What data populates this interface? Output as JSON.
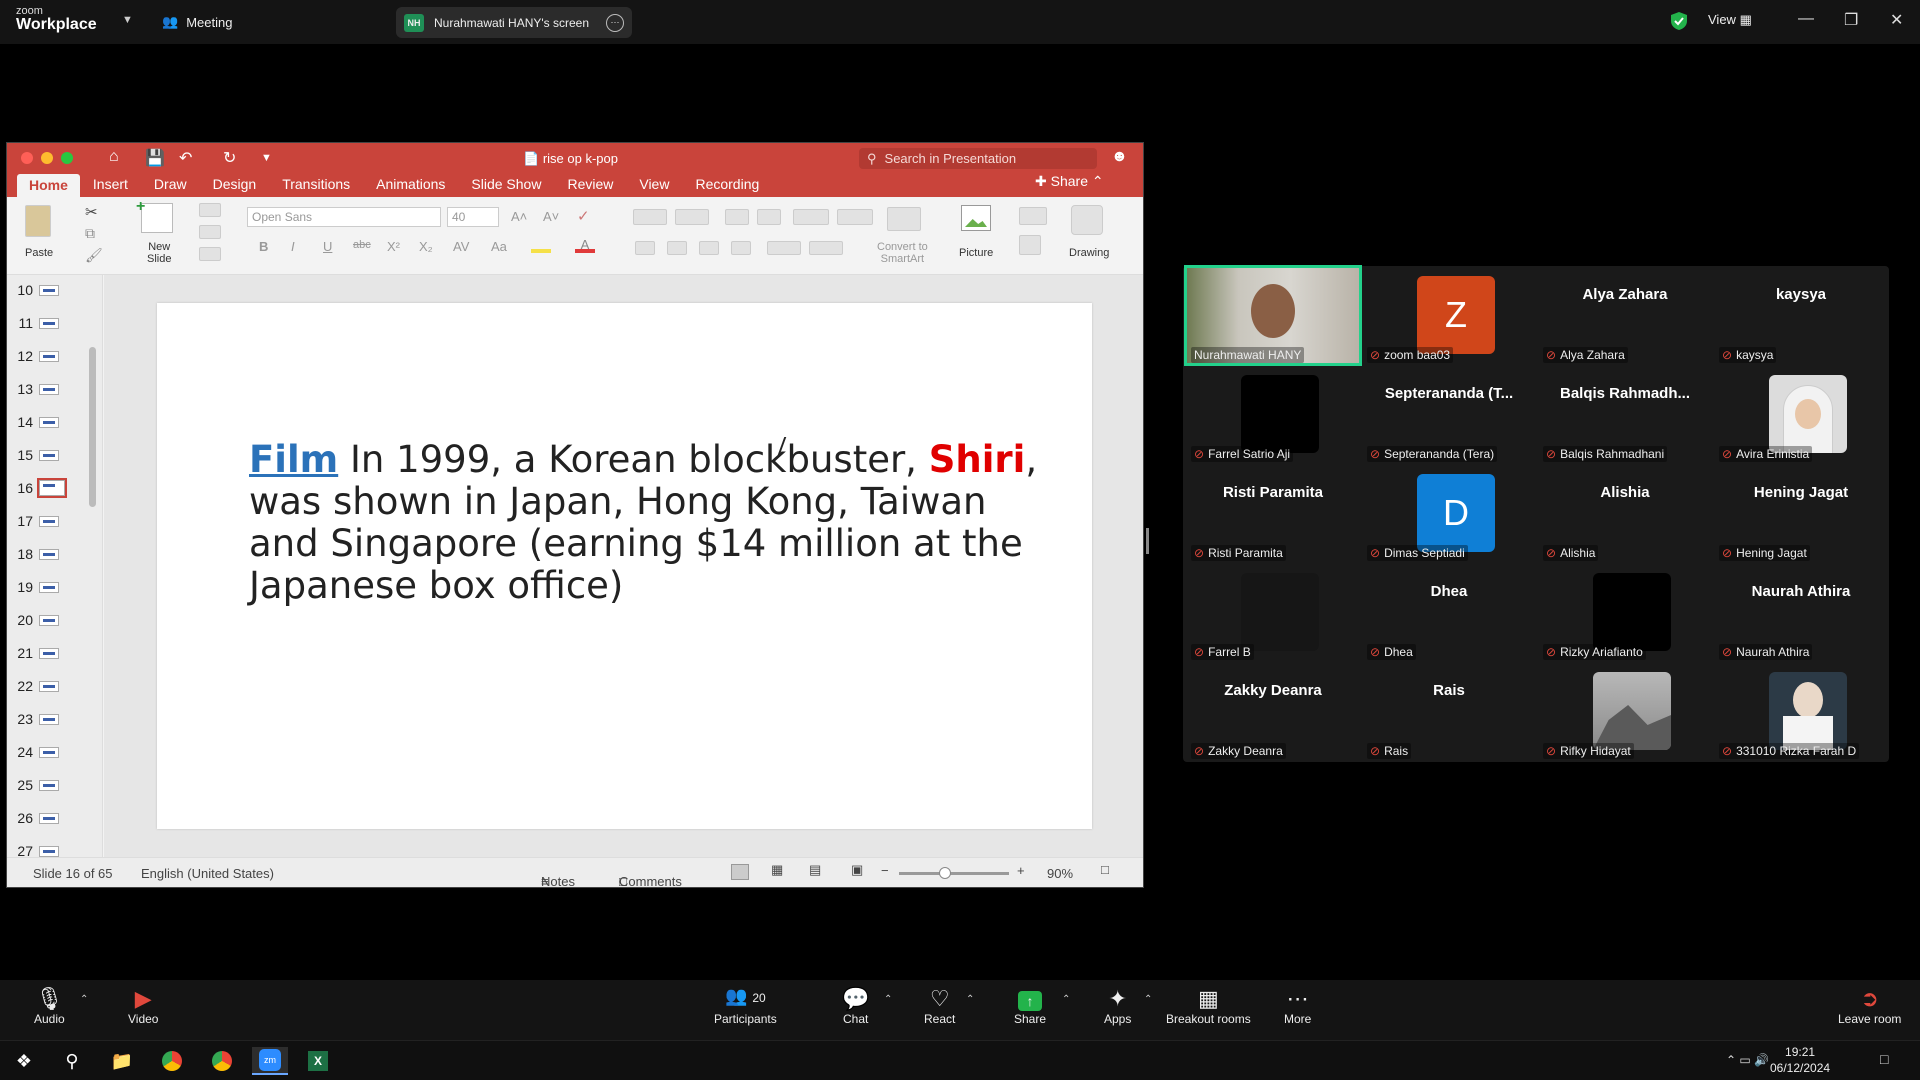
{
  "zoom": {
    "logo_top": "zoom",
    "logo_bottom": "Workplace",
    "meeting_label": "Meeting",
    "screen_pill_initials": "NH",
    "screen_pill_label": "Nurahmawati HANY's screen",
    "view_label": "View",
    "shield_color": "#23b34b"
  },
  "ppt": {
    "doc_title": "rise op k-pop",
    "search_placeholder": "Search in Presentation",
    "share_label": "Share",
    "tabs": [
      "Home",
      "Insert",
      "Draw",
      "Design",
      "Transitions",
      "Animations",
      "Slide Show",
      "Review",
      "View",
      "Recording"
    ],
    "active_tab": "Home",
    "ribbon": {
      "paste": "Paste",
      "new_slide_1": "New",
      "new_slide_2": "Slide",
      "font_name": "Open Sans",
      "font_size": "40",
      "convert_1": "Convert to",
      "convert_2": "SmartArt",
      "picture": "Picture",
      "drawing": "Drawing"
    },
    "thumb_numbers": [
      "10",
      "11",
      "12",
      "13",
      "14",
      "15",
      "16",
      "17",
      "18",
      "19",
      "20",
      "21",
      "22",
      "23",
      "24",
      "25",
      "26",
      "27"
    ],
    "selected_thumb": "16",
    "slide": {
      "kw1": "Film",
      "text1": " In 1999, a Korean blockbuster, ",
      "kw2": "Shiri",
      "text2": ", was shown in Japan, Hong Kong, Taiwan and Singapore (earning $14 million at the Japanese box office)"
    },
    "status": {
      "slide_count": "Slide 16 of 65",
      "language": "English (United States)",
      "notes": "Notes",
      "comments": "Comments",
      "zoom": "90%",
      "zoom_level": 0.42
    }
  },
  "gallery": {
    "speaker_color": "#23d18b",
    "tiles": [
      {
        "center": "",
        "name": "Nurahmawati HANY",
        "kind": "video"
      },
      {
        "center": "Z",
        "name": "zoom baa03",
        "kind": "avatar",
        "color": "#d0461a"
      },
      {
        "center": "Alya Zahara",
        "name": "Alya Zahara",
        "kind": "text"
      },
      {
        "center": "kaysya",
        "name": "kaysya",
        "kind": "text"
      },
      {
        "center": "",
        "name": "Farrel Satrio Aji",
        "kind": "black"
      },
      {
        "center": "Septerananda  (T...",
        "name": "Septerananda (Tera)",
        "kind": "text"
      },
      {
        "center": "Balqis  Rahmadh...",
        "name": "Balqis Rahmadhani",
        "kind": "text"
      },
      {
        "center": "",
        "name": "Avira Erinistia",
        "kind": "photo-hijab"
      },
      {
        "center": "Risti Paramita",
        "name": "Risti Paramita",
        "kind": "text"
      },
      {
        "center": "D",
        "name": "Dimas Septiadi",
        "kind": "avatar",
        "color": "#0f7fd6"
      },
      {
        "center": "Alishia",
        "name": "Alishia",
        "kind": "text"
      },
      {
        "center": "Hening Jagat",
        "name": "Hening Jagat",
        "kind": "text"
      },
      {
        "center": "",
        "name": "Farrel B",
        "kind": "dark"
      },
      {
        "center": "Dhea",
        "name": "Dhea",
        "kind": "text"
      },
      {
        "center": "",
        "name": "Rizky Ariafianto",
        "kind": "black"
      },
      {
        "center": "Naurah Athira",
        "name": "Naurah Athira",
        "kind": "text"
      },
      {
        "center": "Zakky Deanra",
        "name": "Zakky Deanra",
        "kind": "text"
      },
      {
        "center": "Rais",
        "name": "Rais",
        "kind": "text"
      },
      {
        "center": "",
        "name": "Rifky Hidayat",
        "kind": "photo-mountain"
      },
      {
        "center": "",
        "name": "331010 Rizka Farah D",
        "kind": "photo-person"
      }
    ]
  },
  "toolbar": {
    "audio": "Audio",
    "video": "Video",
    "participants": "Participants",
    "participants_count": "20",
    "chat": "Chat",
    "react": "React",
    "share": "Share",
    "apps": "Apps",
    "breakout": "Breakout rooms",
    "more": "More",
    "leave": "Leave room"
  },
  "taskbar": {
    "time": "19:21",
    "date": "06/12/2024"
  }
}
